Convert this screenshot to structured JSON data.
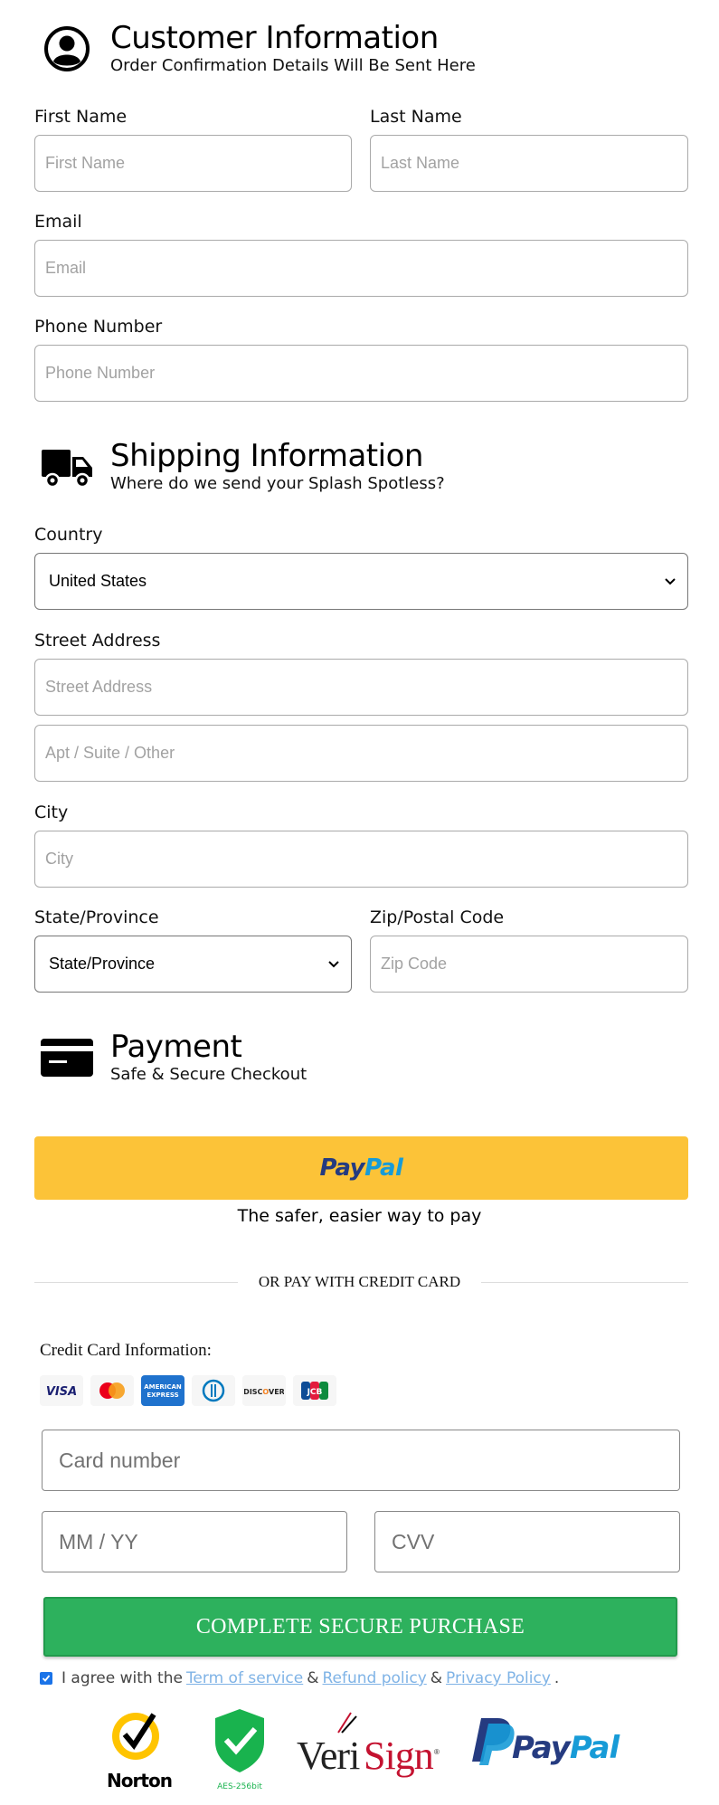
{
  "customer": {
    "title": "Customer Information",
    "subtitle": "Order Confirmation Details Will Be Sent Here",
    "first_name_label": "First Name",
    "first_name_placeholder": "First Name",
    "last_name_label": "Last Name",
    "last_name_placeholder": "Last Name",
    "email_label": "Email",
    "email_placeholder": "Email",
    "phone_label": "Phone Number",
    "phone_placeholder": "Phone Number"
  },
  "shipping": {
    "title": "Shipping Information",
    "subtitle": "Where do we send your Splash Spotless?",
    "country_label": "Country",
    "country_value": "United States",
    "street_label": "Street Address",
    "street_placeholder": "Street Address",
    "apt_placeholder": "Apt / Suite / Other",
    "city_label": "City",
    "city_placeholder": "City",
    "state_label": "State/Province",
    "state_value": "State/Province",
    "zip_label": "Zip/Postal Code",
    "zip_placeholder": "Zip Code"
  },
  "payment": {
    "title": "Payment",
    "subtitle": "Safe & Secure Checkout",
    "paypal_pay": "Pay",
    "paypal_pal": "Pal",
    "paypal_tagline": "The safer, easier way to pay",
    "or_text": "OR PAY WITH CREDIT CARD",
    "cc_title": "Credit Card Information:",
    "card_brands": [
      "VISA",
      "Mastercard",
      "American Express",
      "Diners Club",
      "Discover",
      "JCB"
    ],
    "card_number_placeholder": "Card number",
    "expiry_placeholder": "MM / YY",
    "cvv_placeholder": "CVV",
    "purchase_button": "COMPLETE SECURE PURCHASE",
    "agree_prefix": "I agree with the",
    "terms_link": "Term of service",
    "amp1": "&",
    "refund_link": "Refund policy",
    "amp2": "&",
    "privacy_link": "Privacy Policy",
    "agree_suffix": ".",
    "agree_checked": true
  },
  "trust_badges": {
    "norton": "Norton",
    "aes": "AES-256bit",
    "verisign": "VeriSign",
    "paypal_pay": "Pay",
    "paypal_pal": "Pal"
  },
  "colors": {
    "paypal_yellow": "#fcc338",
    "purchase_green": "#2db15d",
    "link_blue": "#7fb3e6"
  }
}
